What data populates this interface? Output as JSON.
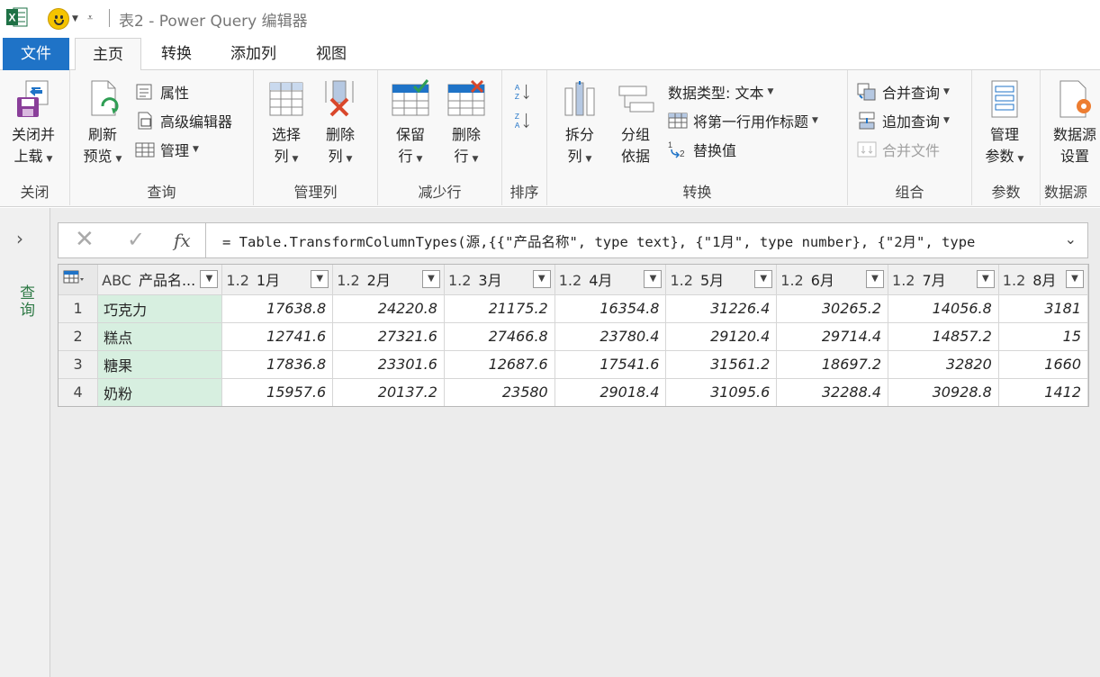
{
  "window": {
    "title": "表2 - Power Query 编辑器"
  },
  "tabs": {
    "file": "文件",
    "home": "主页",
    "transform": "转换",
    "add_column": "添加列",
    "view": "视图"
  },
  "ribbon": {
    "close": {
      "line1": "关闭并",
      "line2": "上载",
      "group": "关闭"
    },
    "query": {
      "refresh1": "刷新",
      "refresh2": "预览",
      "properties": "属性",
      "advanced_editor": "高级编辑器",
      "manage": "管理",
      "group": "查询"
    },
    "manage_columns": {
      "choose1": "选择",
      "choose2": "列",
      "remove1": "删除",
      "remove2": "列",
      "group": "管理列"
    },
    "reduce_rows": {
      "keep1": "保留",
      "keep2": "行",
      "remove1": "删除",
      "remove2": "行",
      "group": "减少行"
    },
    "sort": {
      "group": "排序"
    },
    "transform": {
      "split1": "拆分",
      "split2": "列",
      "groupby1": "分组",
      "groupby2": "依据",
      "datatype": "数据类型: 文本",
      "first_row_header": "将第一行用作标题",
      "replace_values": "替换值",
      "group": "转换"
    },
    "combine": {
      "merge": "合并查询",
      "append": "追加查询",
      "combine_files": "合并文件",
      "group": "组合"
    },
    "parameters": {
      "manage1": "管理",
      "manage2": "参数",
      "group": "参数"
    },
    "datasource": {
      "settings1": "数据源",
      "settings2": "设置",
      "group": "数据源"
    }
  },
  "query_pane": {
    "label": "查询"
  },
  "formula_bar": {
    "text": "= Table.TransformColumnTypes(源,{{\"产品名称\", type text}, {\"1月\", type number}, {\"2月\", type"
  },
  "table": {
    "headers": [
      {
        "type": "ABC",
        "name": "产品名..."
      },
      {
        "type": "1.2",
        "name": "1月"
      },
      {
        "type": "1.2",
        "name": "2月"
      },
      {
        "type": "1.2",
        "name": "3月"
      },
      {
        "type": "1.2",
        "name": "4月"
      },
      {
        "type": "1.2",
        "name": "5月"
      },
      {
        "type": "1.2",
        "name": "6月"
      },
      {
        "type": "1.2",
        "name": "7月"
      },
      {
        "type": "1.2",
        "name": "8月"
      }
    ],
    "rows": [
      {
        "n": "1",
        "cells": [
          "巧克力",
          "17638.8",
          "24220.8",
          "21175.2",
          "16354.8",
          "31226.4",
          "30265.2",
          "14056.8",
          "3181"
        ]
      },
      {
        "n": "2",
        "cells": [
          "糕点",
          "12741.6",
          "27321.6",
          "27466.8",
          "23780.4",
          "29120.4",
          "29714.4",
          "14857.2",
          "15"
        ]
      },
      {
        "n": "3",
        "cells": [
          "糖果",
          "17836.8",
          "23301.6",
          "12687.6",
          "17541.6",
          "31561.2",
          "18697.2",
          "32820",
          "1660"
        ]
      },
      {
        "n": "4",
        "cells": [
          "奶粉",
          "15957.6",
          "20137.2",
          "23580",
          "29018.4",
          "31095.6",
          "32288.4",
          "30928.8",
          "1412"
        ]
      }
    ]
  }
}
